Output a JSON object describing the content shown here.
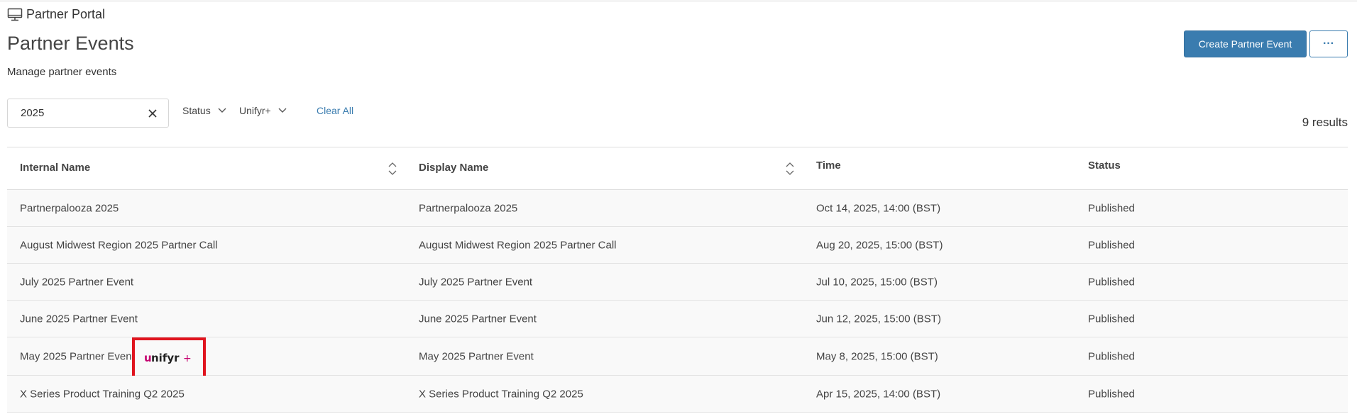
{
  "breadcrumb": {
    "label": "Partner Portal",
    "icon": "monitor-icon"
  },
  "page": {
    "title": "Partner Events",
    "subtitle": "Manage partner events"
  },
  "actions": {
    "create_label": "Create Partner Event",
    "more_label": "···"
  },
  "filters": {
    "search_value": "2025",
    "status_label": "Status",
    "unifyr_label": "Unifyr+",
    "clear_all_label": "Clear All",
    "results_text": "9 results"
  },
  "table": {
    "columns": [
      "Internal Name",
      "Display Name",
      "Time",
      "Status"
    ],
    "rows": [
      {
        "internal": "Partnerpalooza 2025",
        "display": "Partnerpalooza 2025",
        "time": "Oct 14, 2025, 14:00 (BST)",
        "status": "Published"
      },
      {
        "internal": "August Midwest Region 2025 Partner Call",
        "display": "August Midwest Region 2025 Partner Call",
        "time": "Aug 20, 2025, 15:00 (BST)",
        "status": "Published"
      },
      {
        "internal": "July 2025 Partner Event",
        "display": "July 2025 Partner Event",
        "time": "Jul 10, 2025, 15:00 (BST)",
        "status": "Published"
      },
      {
        "internal": "June 2025 Partner Event",
        "display": "June 2025 Partner Event",
        "time": "Jun 12, 2025, 15:00 (BST)",
        "status": "Published"
      },
      {
        "internal": "May 2025 Partner Event",
        "display": "May 2025 Partner Event",
        "time": "May 8, 2025, 15:00 (BST)",
        "status": "Published",
        "badge": "unifyr+"
      },
      {
        "internal": "X Series Product Training Q2 2025",
        "display": "X Series Product Training Q2 2025",
        "time": "Apr 15, 2025, 14:00 (BST)",
        "status": "Published"
      }
    ]
  },
  "colors": {
    "accent": "#3a7caf",
    "highlight_border": "#e0141e",
    "logo_magenta": "#c4006f"
  }
}
